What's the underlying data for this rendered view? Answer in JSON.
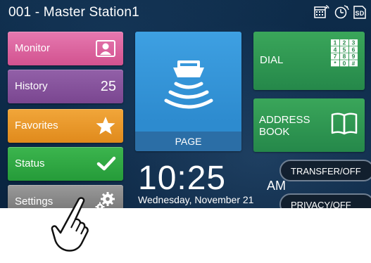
{
  "titlebar": {
    "title": "001 - Master Station1",
    "icons": [
      "calendar-network-icon",
      "clock-timer-icon",
      "sd-card-icon"
    ],
    "sd_text": "SD"
  },
  "menu": {
    "monitor": {
      "label": "Monitor",
      "icon": "monitor-icon",
      "color": "#e06aa3"
    },
    "history": {
      "label": "History",
      "count": "25",
      "color": "#8a55a0"
    },
    "favorites": {
      "label": "Favorites",
      "icon": "star-icon",
      "color": "#ea9a2c"
    },
    "status": {
      "label": "Status",
      "icon": "checkmark-icon",
      "color": "#31aa45"
    },
    "settings": {
      "label": "Settings",
      "icon": "gear-icon",
      "color": "#8e8e8e"
    }
  },
  "page": {
    "label": "PAGE",
    "icon": "speaker-icon",
    "color": "#3598da"
  },
  "dial": {
    "label": "DIAL",
    "icon": "keypad-icon",
    "keys": [
      "1",
      "2",
      "3",
      "4",
      "5",
      "6",
      "7",
      "8",
      "9",
      "*",
      "0",
      "#"
    ]
  },
  "address_book": {
    "label_line1": "ADDRESS",
    "label_line2": "BOOK",
    "icon": "book-icon"
  },
  "clock": {
    "time": "10:25",
    "ampm": "AM",
    "date": "Wednesday, November 21"
  },
  "transfer": {
    "label": "TRANSFER/OFF"
  },
  "privacy": {
    "label": "PRIVACY/OFF"
  },
  "pointer": {
    "icon": "pointing-hand-icon"
  }
}
